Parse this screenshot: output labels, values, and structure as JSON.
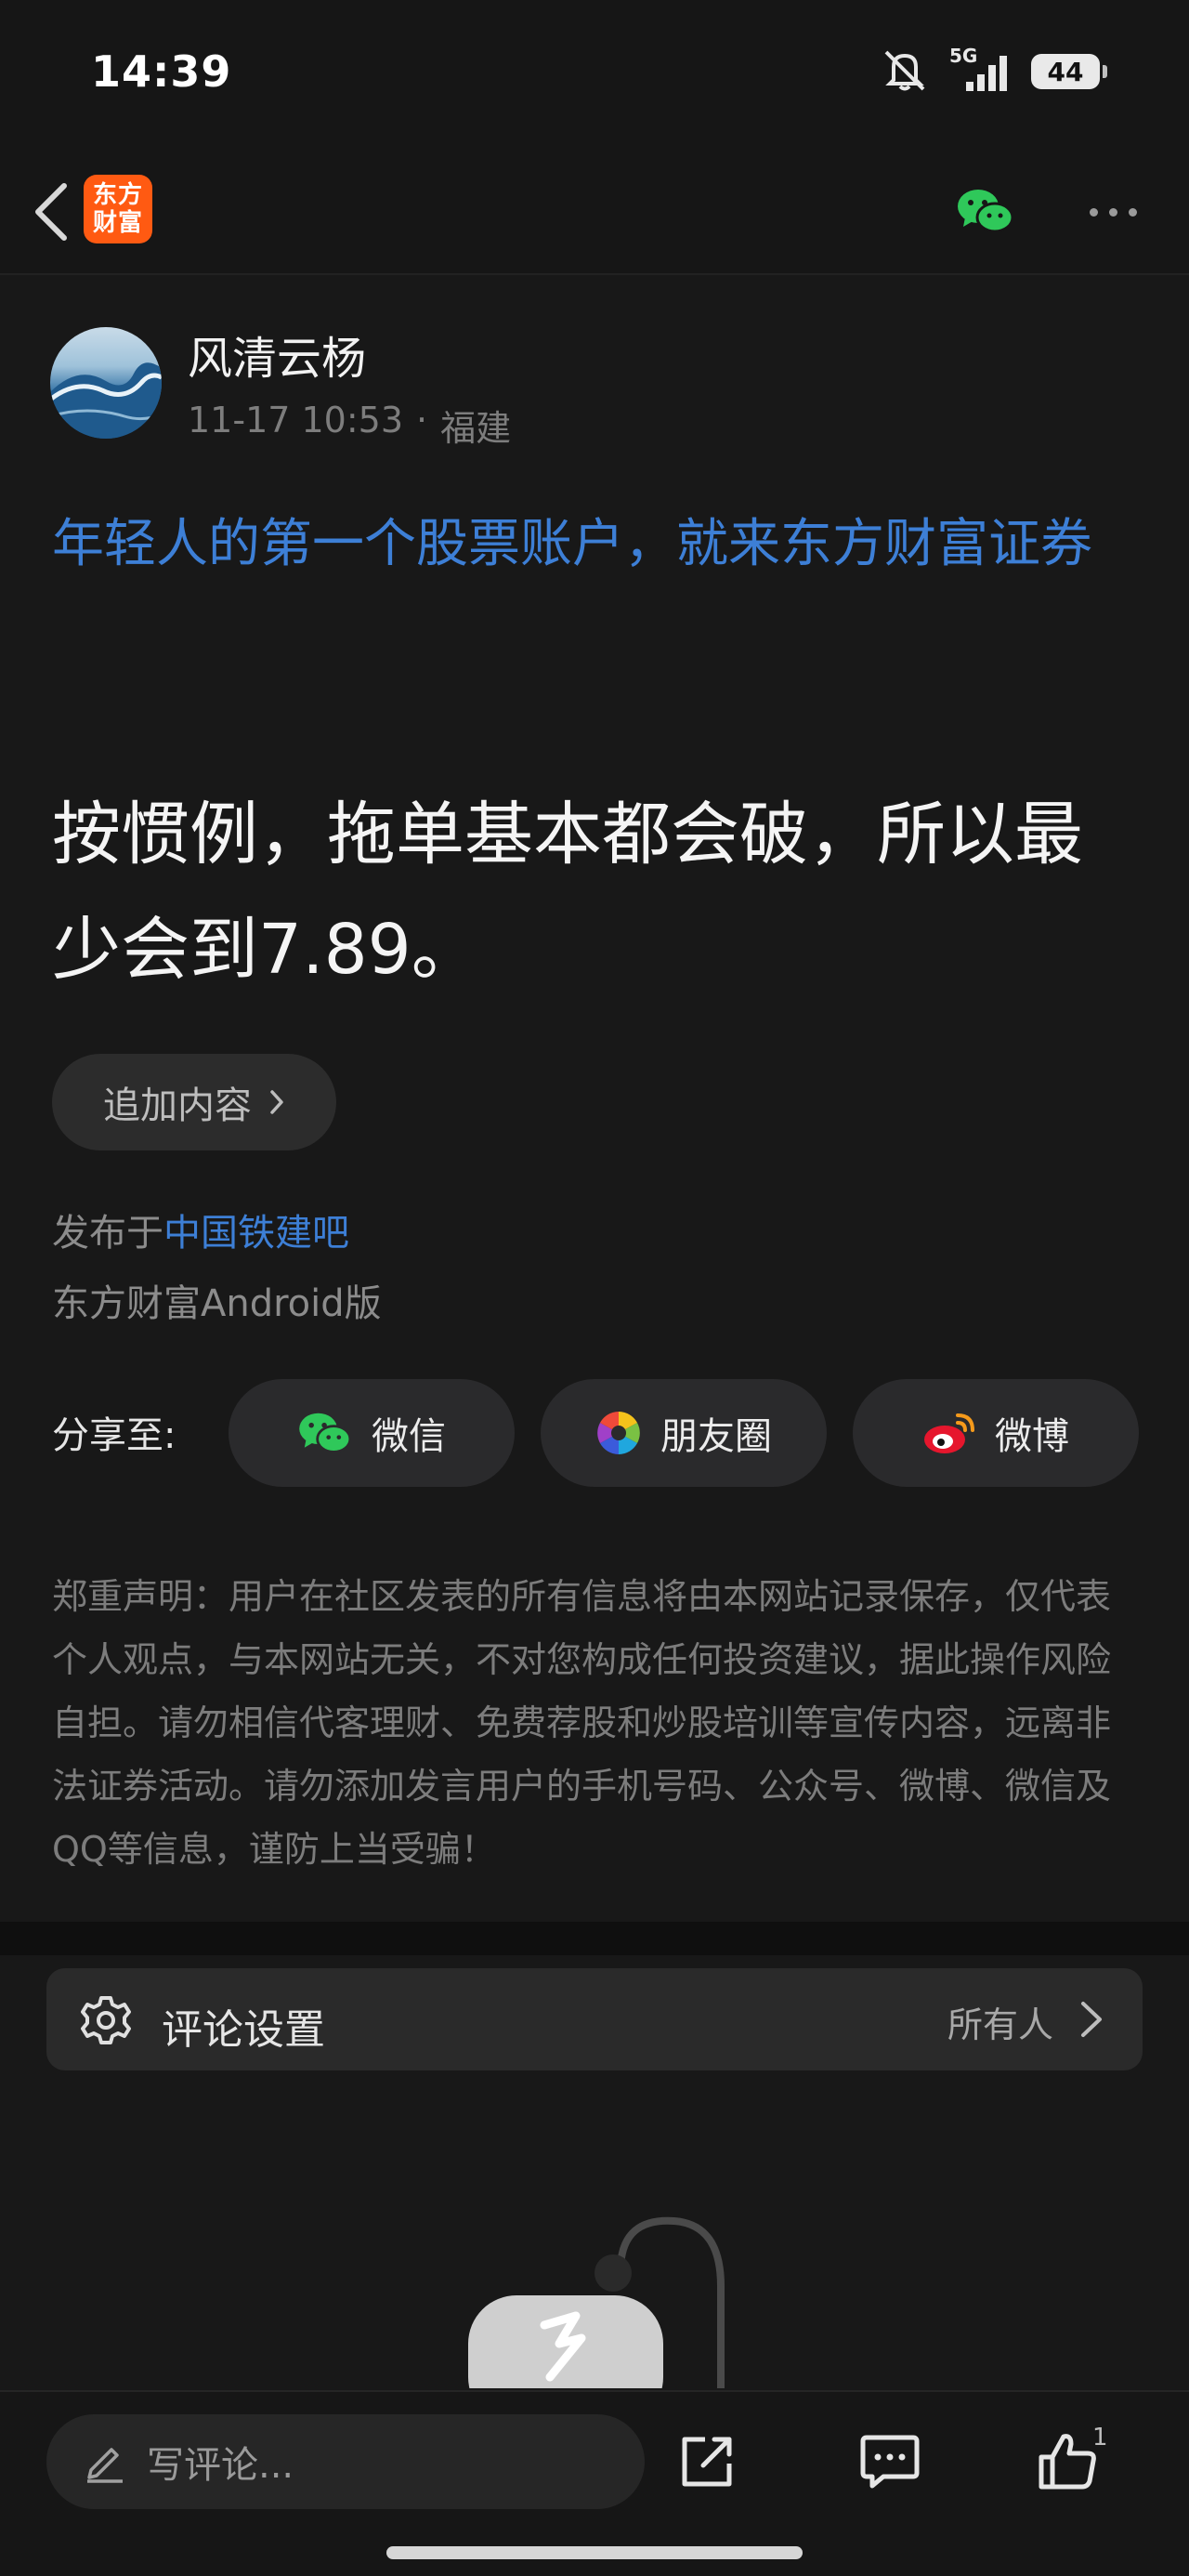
{
  "status_bar": {
    "time": "14:39",
    "network": "5G",
    "battery": "44"
  },
  "nav": {
    "logo_line1": "东方",
    "logo_line2": "财富"
  },
  "author": {
    "name": "风清云杨",
    "time": "11-17 10:53",
    "separator": "·",
    "location": "福建"
  },
  "promo": {
    "text": "年轻人的第一个股票账户，就来东方财富证券"
  },
  "post": {
    "content": "按惯例，拖单基本都会破，所以最少会到7.89。"
  },
  "append": {
    "label": "追加内容"
  },
  "publish": {
    "prefix": "发布于",
    "bar_name": "中国铁建吧",
    "client": "东方财富Android版"
  },
  "share": {
    "label": "分享至:",
    "wechat": "微信",
    "moments": "朋友圈",
    "weibo": "微博"
  },
  "disclaimer": {
    "text": "郑重声明：用户在社区发表的所有信息将由本网站记录保存，仅代表个人观点，与本网站无关，不对您构成任何投资建议，据此操作风险自担。请勿相信代客理财、免费荐股和炒股培训等宣传内容，远离非法证券活动。请勿添加发言用户的手机号码、公众号、微博、微信及QQ等信息，谨防上当受骗！"
  },
  "comment_settings": {
    "label": "评论设置",
    "value": "所有人"
  },
  "bottom_bar": {
    "input_placeholder": "写评论...",
    "like_count": "1"
  },
  "colors": {
    "accent_link": "#3d7fd6",
    "brand_orange": "#ff5a12",
    "wechat_green": "#2fc85a",
    "weibo_red": "#e6162d"
  }
}
